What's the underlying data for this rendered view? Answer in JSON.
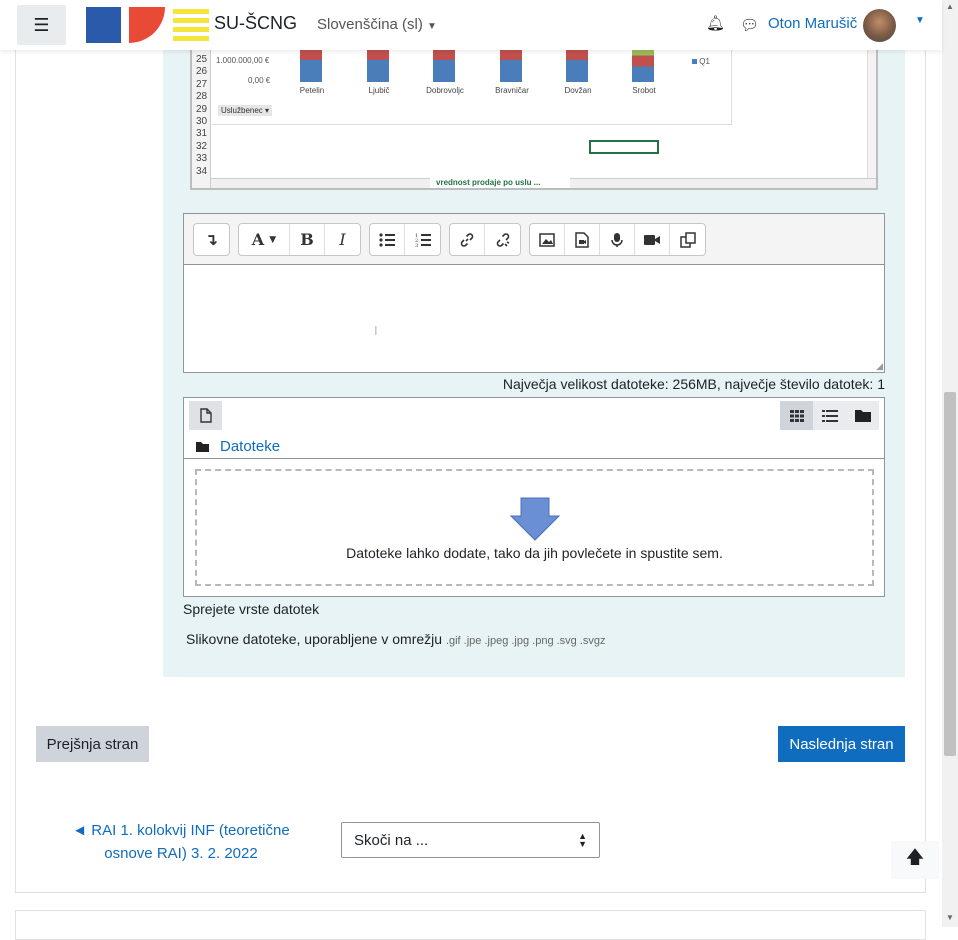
{
  "navbar": {
    "brand": "SU-ŠCNG",
    "language": "Slovenščina (sl)",
    "user_name": "Oton Marušič"
  },
  "spreadsheet": {
    "rows": [
      "25",
      "26",
      "27",
      "28",
      "29",
      "30",
      "31",
      "32",
      "33",
      "34"
    ],
    "y_ticks": [
      "1.000.000,00 €",
      "0,00 €"
    ],
    "categories": [
      "Petelin",
      "Ljubič",
      "Dobrovoljc",
      "Bravničar",
      "Dovžan",
      "Srobot"
    ],
    "legend_q1": "Q1",
    "filter_label": "Uslužbenec",
    "sheet_tab": "vrednost prodaje po uslu"
  },
  "editor": {
    "toolbar": [
      "↴",
      "A",
      "B",
      "I"
    ]
  },
  "files": {
    "max_info": "Največja velikost datoteke: 256MB, največje število datotek: 1",
    "folder": "Datoteke",
    "drop_text": "Datoteke lahko dodate, tako da jih povlečete in spustite sem.",
    "accepted_label": "Sprejete vrste datotek",
    "type_name": "Slikovne datoteke, uporabljene v omrežju",
    "type_exts": ".gif .jpe .jpeg .jpg .png .svg .svgz"
  },
  "nav": {
    "prev": "Prejšnja stran",
    "next": "Naslednja stran",
    "prev_activity": "◄ RAI 1. kolokvij INF (teoretične osnove RAI) 3. 2. 2022",
    "jump": "Skoči na ..."
  }
}
